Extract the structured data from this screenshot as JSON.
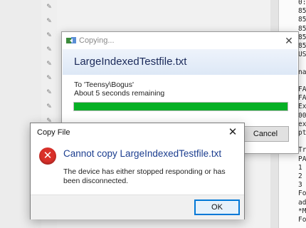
{
  "copy_dialog": {
    "title": "Copying...",
    "file_name": "LargeIndexedTestfile.txt",
    "destination": "To 'Teensy\\Bogus'",
    "time_remaining": "About 5 seconds remaining",
    "progress_fraction": 1.0,
    "progress_color": "#06b025",
    "cancel_label": "Cancel",
    "close_symbol": "✕"
  },
  "error_dialog": {
    "title": "Copy File",
    "heading": "Cannot copy LargeIndexedTestfile.txt",
    "message": "The device has either stopped responding or has been disconnected.",
    "ok_label": "OK",
    "close_symbol": "✕",
    "icon": "error-x-icon",
    "icon_color": "#d9302a"
  },
  "editor_lines": [
    "0:",
    "85",
    "85",
    "85",
    "85",
    "85",
    "US",
    "",
    "na",
    "",
    "FA",
    "FA",
    "Ex",
    "00",
    "ex",
    "pt",
    "",
    "Tr",
    "PA",
    "1",
    "2",
    "3",
    "Fo",
    "ad",
    "*M",
    "Fo"
  ]
}
